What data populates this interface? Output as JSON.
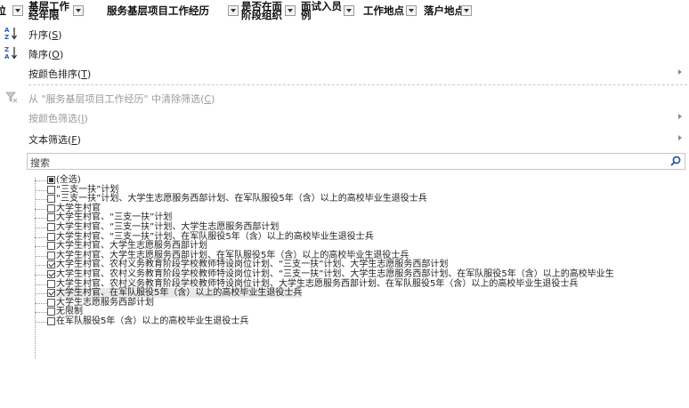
{
  "header": {
    "columns": [
      {
        "label": "岗位"
      },
      {
        "label": "基层工作\n经年限"
      },
      {
        "label": "服务基层项目工作经历"
      },
      {
        "label": "是否在面\n阶段组织"
      },
      {
        "label": "面试入员\n例"
      },
      {
        "label": "工作地点"
      },
      {
        "label": "落户地点"
      }
    ]
  },
  "menu": {
    "sort_asc": {
      "text": "升序(",
      "key": "S",
      "end": ")"
    },
    "sort_desc": {
      "text": "降序(",
      "key": "O",
      "end": ")"
    },
    "sort_by_color": {
      "text": "按颜色排序(",
      "key": "T",
      "end": ")"
    },
    "clear_filter": {
      "text": "从 \"服务基层项目工作经历\" 中清除筛选(",
      "key": "C",
      "end": ")"
    },
    "filter_by_color": {
      "text": "按颜色筛选(",
      "key": "I",
      "end": ")"
    },
    "text_filter": {
      "text": "文本筛选(",
      "key": "F",
      "end": ")"
    }
  },
  "search": {
    "placeholder": "搜索"
  },
  "filter_items": [
    {
      "label": "(全选)",
      "state": "indeterminate"
    },
    {
      "label": "“三支一扶”计划",
      "state": "unchecked"
    },
    {
      "label": "“三支一扶”计划、大学生志愿服务西部计划、在军队服役5年（含）以上的高校毕业生退役士兵",
      "state": "unchecked"
    },
    {
      "label": "大学生村官",
      "state": "unchecked"
    },
    {
      "label": "大学生村官、“三支一扶”计划",
      "state": "unchecked"
    },
    {
      "label": "大学生村官、“三支一扶”计划、大学生志愿服务西部计划",
      "state": "unchecked"
    },
    {
      "label": "大学生村官、“三支一扶”计划、在军队服役5年（含）以上的高校毕业生退役士兵",
      "state": "unchecked"
    },
    {
      "label": "大学生村官、大学生志愿服务西部计划",
      "state": "unchecked"
    },
    {
      "label": "大学生村官、大学生志愿服务西部计划、在军队服役5年（含）以上的高校毕业生退役士兵",
      "state": "unchecked"
    },
    {
      "label": "大学生村官、农村义务教育阶段学校教师特设岗位计划、“三支一扶”计划、大学生志愿服务西部计划",
      "state": "checked"
    },
    {
      "label": "大学生村官、农村义务教育阶段学校教师特设岗位计划、“三支一扶”计划、大学生志愿服务西部计划、在军队服役5年（含）以上的高校毕业生",
      "state": "checked"
    },
    {
      "label": "大学生村官、农村义务教育阶段学校教师特设岗位计划、大学生志愿服务西部计划、在军队服役5年（含）以上的高校毕业生退役士兵",
      "state": "unchecked"
    },
    {
      "label": "大学生村官、在军队服役5年（含）以上的高校毕业生退役士兵",
      "state": "checked",
      "selected": true
    },
    {
      "label": "大学生志愿服务西部计划",
      "state": "unchecked"
    },
    {
      "label": "无限制",
      "state": "unchecked"
    },
    {
      "label": "在军队服役5年（含）以上的高校毕业生退役士兵",
      "state": "unchecked"
    }
  ]
}
